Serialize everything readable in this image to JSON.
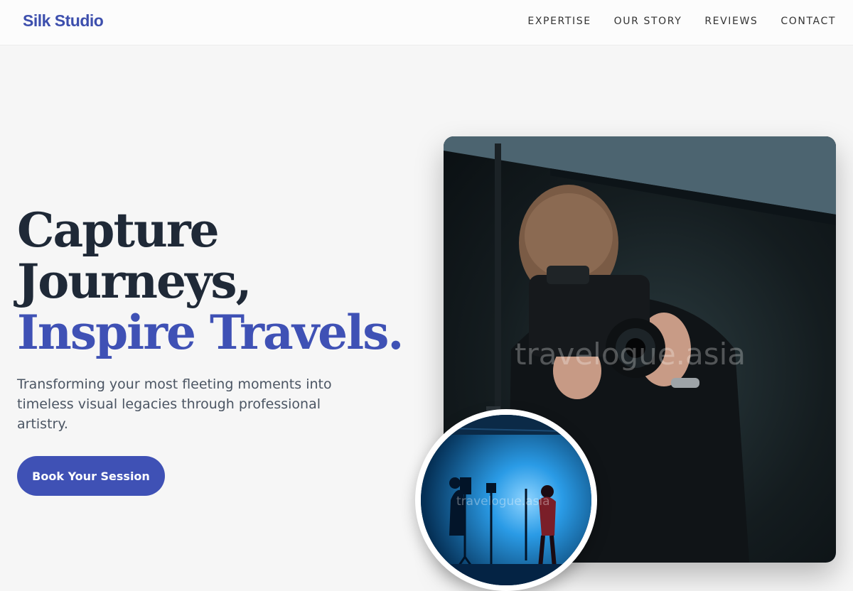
{
  "header": {
    "logo": "Silk Studio",
    "nav": [
      {
        "label": "EXPERTISE"
      },
      {
        "label": "OUR STORY"
      },
      {
        "label": "REVIEWS"
      },
      {
        "label": "CONTACT"
      }
    ]
  },
  "hero": {
    "heading_line1": "Capture",
    "heading_line2": "Journeys,",
    "heading_line3": "Inspire Travels.",
    "description": "Transforming your most fleeting moments into timeless visual legacies through professional artistry.",
    "cta_label": "Book Your Session"
  },
  "images": {
    "main_watermark": "travelogue.asia",
    "inset_watermark": "travelogue.asia"
  },
  "colors": {
    "accent": "#3f51b5",
    "heading": "#1f2937",
    "body_text": "#4b5563",
    "page_background": "#f6f6f6"
  }
}
